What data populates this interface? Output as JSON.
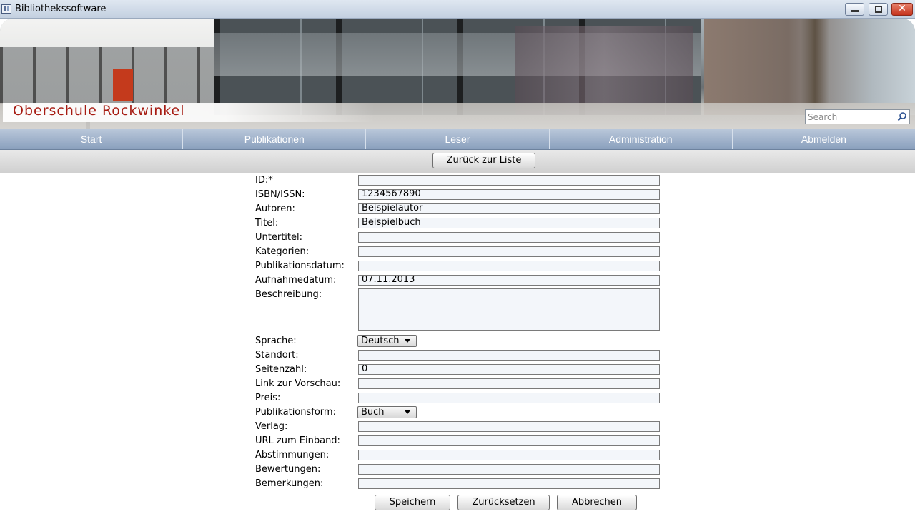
{
  "window": {
    "title": "Bibliothekssoftware"
  },
  "banner": {
    "school_name": "Oberschule Rockwinkel",
    "search_placeholder": "Search"
  },
  "nav": {
    "items": [
      "Start",
      "Publikationen",
      "Leser",
      "Administration",
      "Abmelden"
    ]
  },
  "toolbar": {
    "back_label": "Zurück zur Liste"
  },
  "form": {
    "fields": [
      {
        "label": "ID:*",
        "value": ""
      },
      {
        "label": "ISBN/ISSN:",
        "value": "1234567890"
      },
      {
        "label": "Autoren:",
        "value": "Beispielautor"
      },
      {
        "label": "Titel:",
        "value": "Beispielbuch"
      },
      {
        "label": "Untertitel:",
        "value": ""
      },
      {
        "label": "Kategorien:",
        "value": ""
      },
      {
        "label": "Publikationsdatum:",
        "value": ""
      },
      {
        "label": "Aufnahmedatum:",
        "value": "07.11.2013"
      },
      {
        "label": "Beschreibung:",
        "value": ""
      },
      {
        "label": "Sprache:",
        "value": "Deutsch"
      },
      {
        "label": "Standort:",
        "value": ""
      },
      {
        "label": "Seitenzahl:",
        "value": "0"
      },
      {
        "label": "Link zur Vorschau:",
        "value": ""
      },
      {
        "label": "Preis:",
        "value": ""
      },
      {
        "label": "Publikationsform:",
        "value": "Buch"
      },
      {
        "label": "Verlag:",
        "value": ""
      },
      {
        "label": "URL zum Einband:",
        "value": ""
      },
      {
        "label": "Abstimmungen:",
        "value": ""
      },
      {
        "label": "Bewertungen:",
        "value": ""
      },
      {
        "label": "Bemerkungen:",
        "value": ""
      }
    ]
  },
  "actions": {
    "save_label": "Speichern",
    "reset_label": "Zurücksetzen",
    "cancel_label": "Abbrechen"
  }
}
